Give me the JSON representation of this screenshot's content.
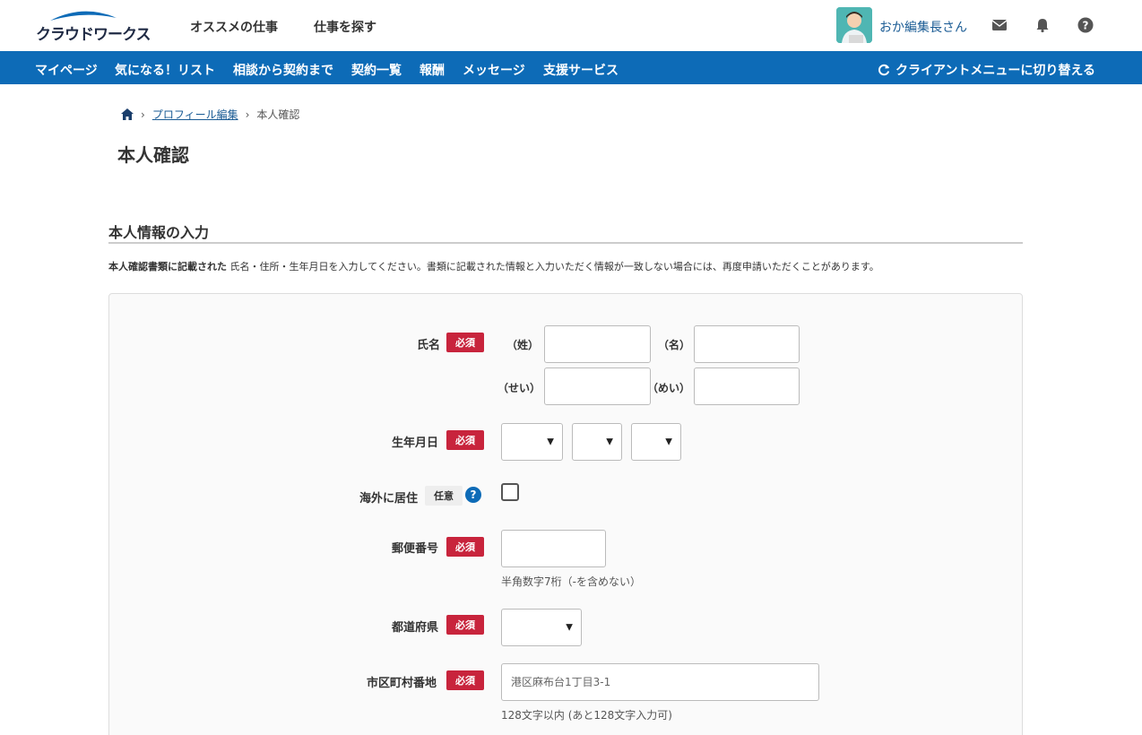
{
  "header": {
    "logo_text": "クラウドワークス",
    "nav": [
      "オススメの仕事",
      "仕事を探す"
    ],
    "username": "おか編集長さん",
    "icons": [
      "mail-icon",
      "bell-icon",
      "help-icon"
    ]
  },
  "bluenav": {
    "items": [
      "マイページ",
      "気になる！リスト",
      "相談から契約まで",
      "契約一覧",
      "報酬",
      "メッセージ",
      "支援サービス"
    ],
    "switch_label": "クライアントメニューに切り替える"
  },
  "breadcrumb": {
    "link": "プロフィール編集",
    "current": "本人確認"
  },
  "page_title": "本人確認",
  "section": {
    "title": "本人情報の入力",
    "intro_bold": "本人確認書類に記載された",
    "intro_rest": " 氏名・住所・生年月日を入力してください。書類に記載された情報と入力いただく情報が一致しない場合には、再度申請いただくことがあります。"
  },
  "form": {
    "required_badge": "必須",
    "optional_badge": "任意",
    "name": {
      "label": "氏名",
      "sei": "（姓）",
      "mei": "（名）",
      "sei_kana": "（せい）",
      "mei_kana": "（めい）",
      "sei_value": "",
      "mei_value": "",
      "sei_kana_value": "",
      "mei_kana_value": ""
    },
    "birthdate": {
      "label": "生年月日",
      "year": "",
      "month": "",
      "day": ""
    },
    "overseas": {
      "label": "海外に居住",
      "checked": false
    },
    "postal": {
      "label": "郵便番号",
      "value": "",
      "hint": "半角数字7桁（-を含めない）"
    },
    "prefecture": {
      "label": "都道府県",
      "value": ""
    },
    "address": {
      "label": "市区町村番地",
      "placeholder": "港区麻布台1丁目3-1",
      "value": "",
      "hint": "128文字以内 (あと128文字入力可)"
    }
  }
}
